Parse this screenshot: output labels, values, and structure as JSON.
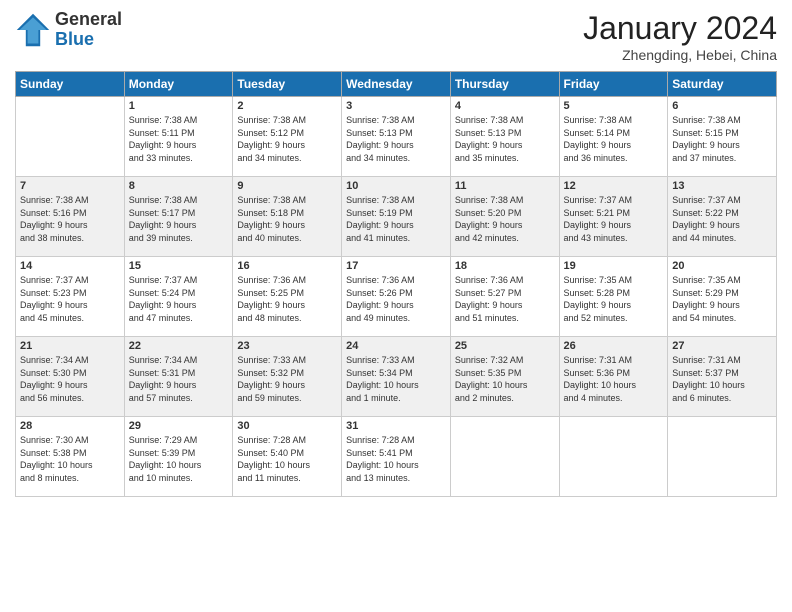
{
  "header": {
    "logo_general": "General",
    "logo_blue": "Blue",
    "month_title": "January 2024",
    "location": "Zhengding, Hebei, China"
  },
  "days_of_week": [
    "Sunday",
    "Monday",
    "Tuesday",
    "Wednesday",
    "Thursday",
    "Friday",
    "Saturday"
  ],
  "weeks": [
    [
      {
        "day": "",
        "info": ""
      },
      {
        "day": "1",
        "info": "Sunrise: 7:38 AM\nSunset: 5:11 PM\nDaylight: 9 hours\nand 33 minutes."
      },
      {
        "day": "2",
        "info": "Sunrise: 7:38 AM\nSunset: 5:12 PM\nDaylight: 9 hours\nand 34 minutes."
      },
      {
        "day": "3",
        "info": "Sunrise: 7:38 AM\nSunset: 5:13 PM\nDaylight: 9 hours\nand 34 minutes."
      },
      {
        "day": "4",
        "info": "Sunrise: 7:38 AM\nSunset: 5:13 PM\nDaylight: 9 hours\nand 35 minutes."
      },
      {
        "day": "5",
        "info": "Sunrise: 7:38 AM\nSunset: 5:14 PM\nDaylight: 9 hours\nand 36 minutes."
      },
      {
        "day": "6",
        "info": "Sunrise: 7:38 AM\nSunset: 5:15 PM\nDaylight: 9 hours\nand 37 minutes."
      }
    ],
    [
      {
        "day": "7",
        "info": "Sunrise: 7:38 AM\nSunset: 5:16 PM\nDaylight: 9 hours\nand 38 minutes."
      },
      {
        "day": "8",
        "info": "Sunrise: 7:38 AM\nSunset: 5:17 PM\nDaylight: 9 hours\nand 39 minutes."
      },
      {
        "day": "9",
        "info": "Sunrise: 7:38 AM\nSunset: 5:18 PM\nDaylight: 9 hours\nand 40 minutes."
      },
      {
        "day": "10",
        "info": "Sunrise: 7:38 AM\nSunset: 5:19 PM\nDaylight: 9 hours\nand 41 minutes."
      },
      {
        "day": "11",
        "info": "Sunrise: 7:38 AM\nSunset: 5:20 PM\nDaylight: 9 hours\nand 42 minutes."
      },
      {
        "day": "12",
        "info": "Sunrise: 7:37 AM\nSunset: 5:21 PM\nDaylight: 9 hours\nand 43 minutes."
      },
      {
        "day": "13",
        "info": "Sunrise: 7:37 AM\nSunset: 5:22 PM\nDaylight: 9 hours\nand 44 minutes."
      }
    ],
    [
      {
        "day": "14",
        "info": "Sunrise: 7:37 AM\nSunset: 5:23 PM\nDaylight: 9 hours\nand 45 minutes."
      },
      {
        "day": "15",
        "info": "Sunrise: 7:37 AM\nSunset: 5:24 PM\nDaylight: 9 hours\nand 47 minutes."
      },
      {
        "day": "16",
        "info": "Sunrise: 7:36 AM\nSunset: 5:25 PM\nDaylight: 9 hours\nand 48 minutes."
      },
      {
        "day": "17",
        "info": "Sunrise: 7:36 AM\nSunset: 5:26 PM\nDaylight: 9 hours\nand 49 minutes."
      },
      {
        "day": "18",
        "info": "Sunrise: 7:36 AM\nSunset: 5:27 PM\nDaylight: 9 hours\nand 51 minutes."
      },
      {
        "day": "19",
        "info": "Sunrise: 7:35 AM\nSunset: 5:28 PM\nDaylight: 9 hours\nand 52 minutes."
      },
      {
        "day": "20",
        "info": "Sunrise: 7:35 AM\nSunset: 5:29 PM\nDaylight: 9 hours\nand 54 minutes."
      }
    ],
    [
      {
        "day": "21",
        "info": "Sunrise: 7:34 AM\nSunset: 5:30 PM\nDaylight: 9 hours\nand 56 minutes."
      },
      {
        "day": "22",
        "info": "Sunrise: 7:34 AM\nSunset: 5:31 PM\nDaylight: 9 hours\nand 57 minutes."
      },
      {
        "day": "23",
        "info": "Sunrise: 7:33 AM\nSunset: 5:32 PM\nDaylight: 9 hours\nand 59 minutes."
      },
      {
        "day": "24",
        "info": "Sunrise: 7:33 AM\nSunset: 5:34 PM\nDaylight: 10 hours\nand 1 minute."
      },
      {
        "day": "25",
        "info": "Sunrise: 7:32 AM\nSunset: 5:35 PM\nDaylight: 10 hours\nand 2 minutes."
      },
      {
        "day": "26",
        "info": "Sunrise: 7:31 AM\nSunset: 5:36 PM\nDaylight: 10 hours\nand 4 minutes."
      },
      {
        "day": "27",
        "info": "Sunrise: 7:31 AM\nSunset: 5:37 PM\nDaylight: 10 hours\nand 6 minutes."
      }
    ],
    [
      {
        "day": "28",
        "info": "Sunrise: 7:30 AM\nSunset: 5:38 PM\nDaylight: 10 hours\nand 8 minutes."
      },
      {
        "day": "29",
        "info": "Sunrise: 7:29 AM\nSunset: 5:39 PM\nDaylight: 10 hours\nand 10 minutes."
      },
      {
        "day": "30",
        "info": "Sunrise: 7:28 AM\nSunset: 5:40 PM\nDaylight: 10 hours\nand 11 minutes."
      },
      {
        "day": "31",
        "info": "Sunrise: 7:28 AM\nSunset: 5:41 PM\nDaylight: 10 hours\nand 13 minutes."
      },
      {
        "day": "",
        "info": ""
      },
      {
        "day": "",
        "info": ""
      },
      {
        "day": "",
        "info": ""
      }
    ]
  ]
}
